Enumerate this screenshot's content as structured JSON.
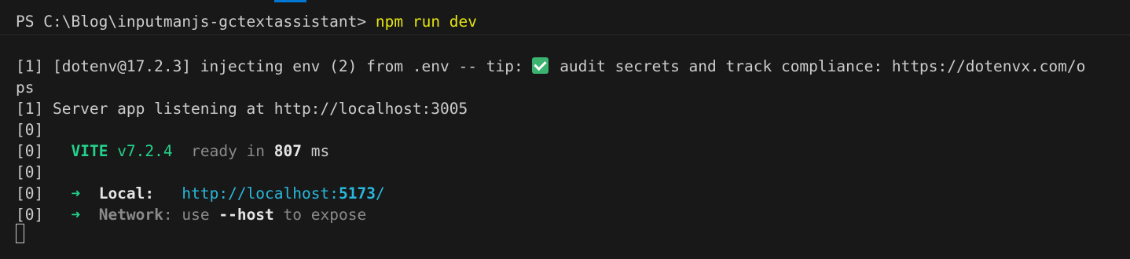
{
  "prompt": {
    "path": "PS C:\\Blog\\inputmanjs-gctextassistant> ",
    "command": "npm run dev"
  },
  "output": {
    "dotenv": {
      "prefix": "[1] [dotenv@17.2.3] injecting env (2) from .env -- tip: ",
      "emoji_icon": "check-mark-button",
      "suffix": " audit secrets and track compliance: https://dotenvx.com/o",
      "wrap": "ps"
    },
    "server": "[1] Server app listening at http://localhost:3005",
    "blank_1": "[0]",
    "vite": {
      "tag": "[0]",
      "name": "VITE",
      "version": "v7.2.4",
      "ready_text": "ready in",
      "time": "807",
      "unit": "ms"
    },
    "blank_2": "[0]",
    "local": {
      "tag": "[0]",
      "arrow": "➜",
      "label": "Local:",
      "url_prefix": "http://localhost:",
      "port": "5173",
      "url_suffix": "/"
    },
    "network": {
      "tag": "[0]",
      "arrow": "➜",
      "label": "Network",
      "text1": ": use ",
      "flag": "--host",
      "text2": " to expose"
    }
  },
  "colors": {
    "background": "#181818",
    "command": "#e5e510",
    "vite": "#23d18b",
    "url": "#29b8db"
  }
}
